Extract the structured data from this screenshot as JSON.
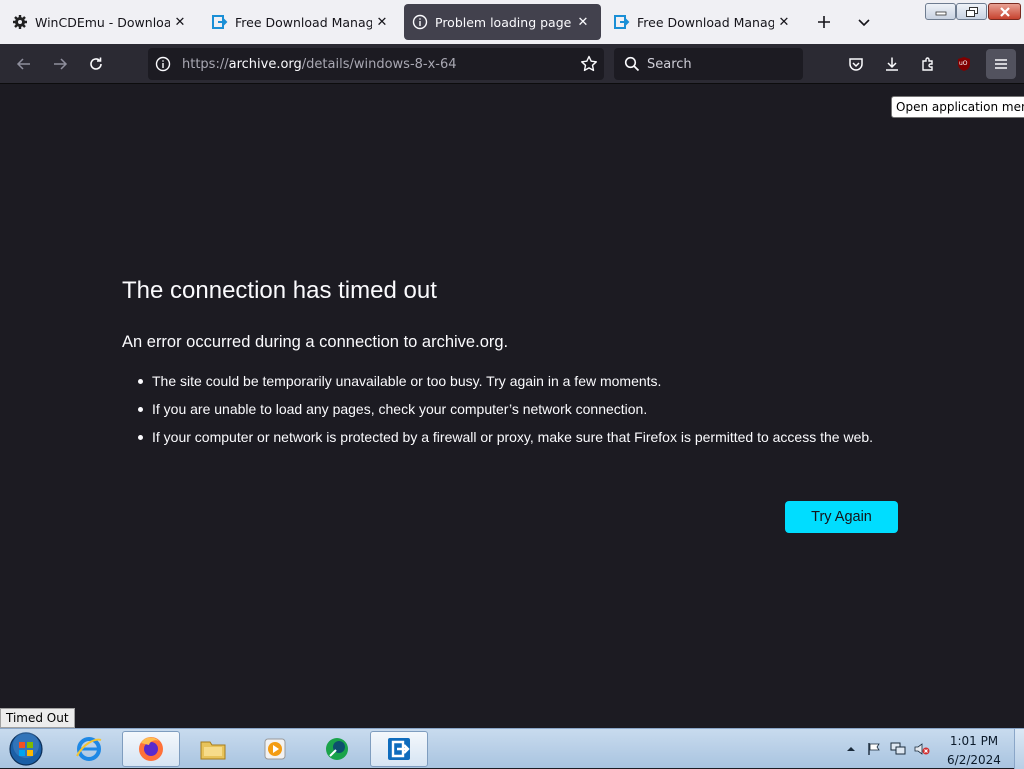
{
  "tabs": [
    {
      "title": "WinCDEmu - Download",
      "icon": "gear-icon"
    },
    {
      "title": "Free Download Manager - ",
      "icon": "fdm-icon"
    },
    {
      "title": "Problem loading page",
      "icon": "info-icon"
    },
    {
      "title": "Free Download Manager - ",
      "icon": "fdm-icon"
    }
  ],
  "url": {
    "prefix": "https://",
    "domain": "archive.org",
    "path": "/details/windows-8-x-64"
  },
  "search": {
    "label": "Search"
  },
  "tooltip": {
    "text": "Open application menu"
  },
  "error": {
    "title": "The connection has timed out",
    "short": "An error occurred during a connection to archive.org.",
    "items": [
      "The site could be temporarily unavailable or too busy. Try again in a few moments.",
      "If you are unable to load any pages, check your computer’s network connection.",
      "If your computer or network is protected by a firewall or proxy, make sure that Firefox is permitted to access the web."
    ],
    "button": "Try Again"
  },
  "status": {
    "text": "Timed Out"
  },
  "clock": {
    "time": "1:01 PM",
    "date": "6/2/2024"
  },
  "extension_badge": "uO",
  "colors": {
    "accent": "#00ddff",
    "page_bg": "#1c1b22",
    "toolbar_bg": "#2b2a33"
  }
}
